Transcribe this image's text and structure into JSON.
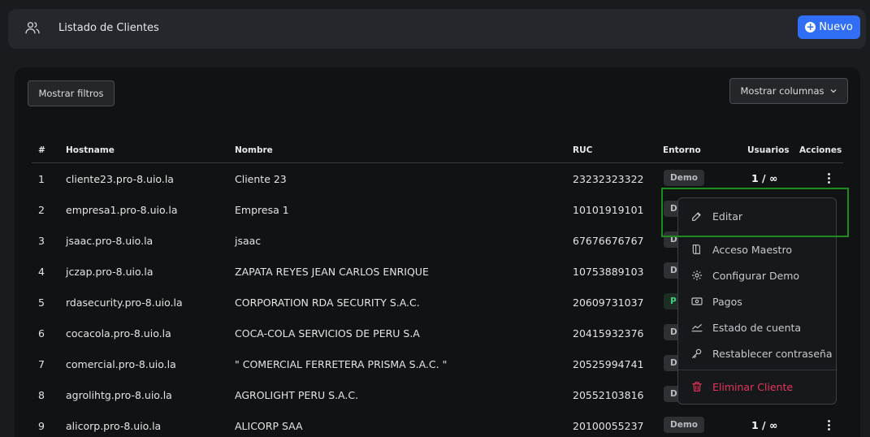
{
  "header": {
    "title": "Listado de Clientes",
    "new_button": "Nuevo",
    "icon": "users-icon"
  },
  "toolbar": {
    "filters_button": "Mostrar filtros",
    "columns_button": "Mostrar columnas"
  },
  "table": {
    "headers": {
      "num": "#",
      "hostname": "Hostname",
      "nombre": "Nombre",
      "ruc": "RUC",
      "entorno": "Entorno",
      "usuarios": "Usuarios",
      "acciones": "Acciones"
    },
    "rows": [
      {
        "num": "1",
        "hostname": "cliente23.pro-8.uio.la",
        "nombre": "Cliente 23",
        "ruc": "23232323322",
        "entorno": "Demo",
        "usuarios": "1 / ∞"
      },
      {
        "num": "2",
        "hostname": "empresa1.pro-8.uio.la",
        "nombre": "Empresa 1",
        "ruc": "10101919101",
        "entorno": "D",
        "usuarios": ""
      },
      {
        "num": "3",
        "hostname": "jsaac.pro-8.uio.la",
        "nombre": "jsaac",
        "ruc": "67676676767",
        "entorno": "D",
        "usuarios": ""
      },
      {
        "num": "4",
        "hostname": "jczap.pro-8.uio.la",
        "nombre": "ZAPATA REYES JEAN CARLOS ENRIQUE",
        "ruc": "10753889103",
        "entorno": "D",
        "usuarios": ""
      },
      {
        "num": "5",
        "hostname": "rdasecurity.pro-8.uio.la",
        "nombre": "CORPORATION RDA SECURITY S.A.C.",
        "ruc": "20609731037",
        "entorno": "P",
        "usuarios": ""
      },
      {
        "num": "6",
        "hostname": "cocacola.pro-8.uio.la",
        "nombre": "COCA-COLA SERVICIOS DE PERU S.A",
        "ruc": "20415932376",
        "entorno": "D",
        "usuarios": ""
      },
      {
        "num": "7",
        "hostname": "comercial.pro-8.uio.la",
        "nombre": "\" COMERCIAL FERRETERA PRISMA S.A.C. \"",
        "ruc": "20525994741",
        "entorno": "D",
        "usuarios": ""
      },
      {
        "num": "8",
        "hostname": "agrolihtg.pro-8.uio.la",
        "nombre": "AGROLIGHT PERU S.A.C.",
        "ruc": "20552103816",
        "entorno": "D",
        "usuarios": ""
      },
      {
        "num": "9",
        "hostname": "alicorp.pro-8.uio.la",
        "nombre": "ALICORP SAA",
        "ruc": "20100055237",
        "entorno": "Demo",
        "usuarios": "1 / ∞"
      }
    ]
  },
  "menu": {
    "items": [
      {
        "label": "Editar",
        "icon": "edit-icon"
      },
      {
        "label": "Acceso Maestro",
        "icon": "book-icon"
      },
      {
        "label": "Configurar Demo",
        "icon": "gear-icon"
      },
      {
        "label": "Pagos",
        "icon": "cash-icon"
      },
      {
        "label": "Estado de cuenta",
        "icon": "chart-line-icon"
      },
      {
        "label": "Restablecer contraseña",
        "icon": "key-icon"
      },
      {
        "label": "Eliminar Cliente",
        "icon": "trash-icon"
      }
    ]
  },
  "colors": {
    "accent": "#2f6ef5",
    "danger": "#e8345a",
    "highlight": "#1f8a1f",
    "success": "#3ed17a"
  }
}
